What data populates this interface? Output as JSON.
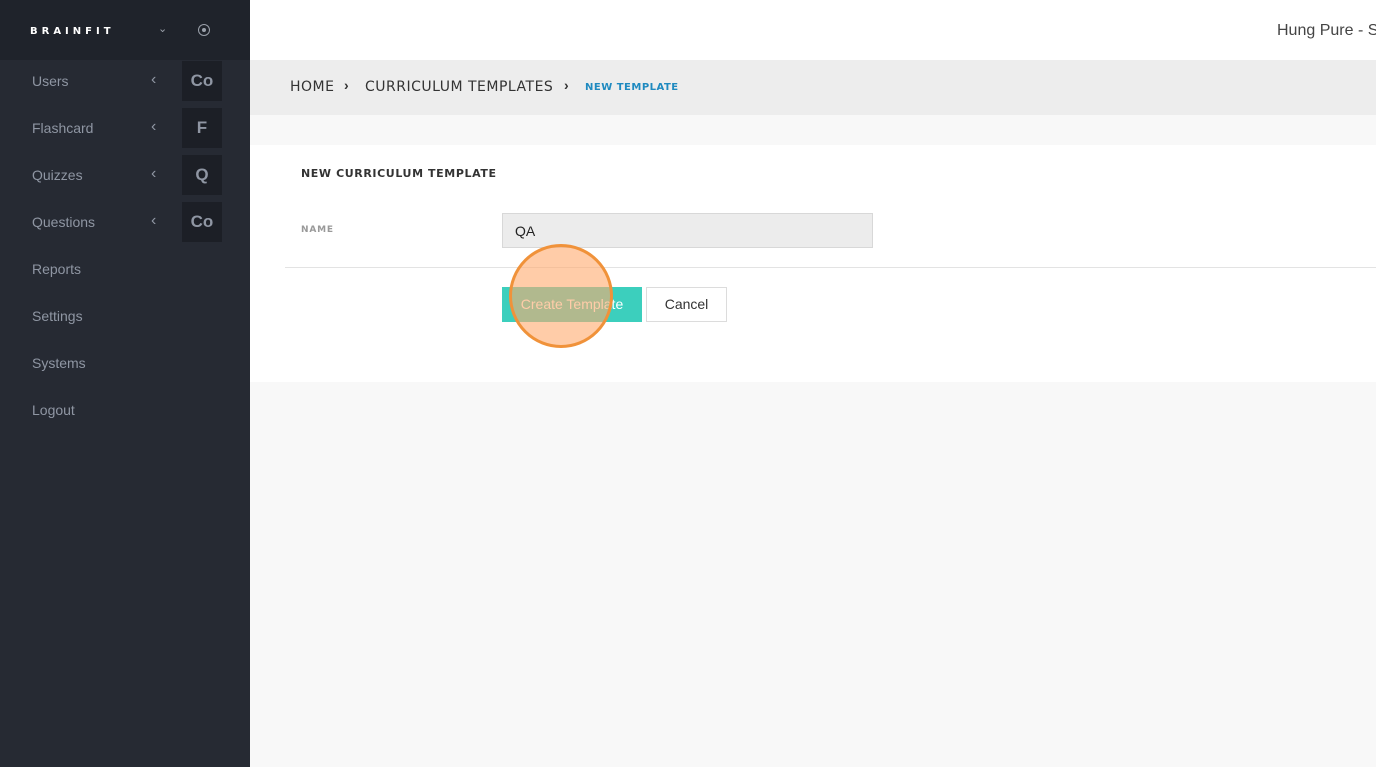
{
  "sidebar": {
    "brand": "BRAINFIT",
    "items": [
      {
        "label": "Users",
        "box": "Co"
      },
      {
        "label": "Flashcard",
        "box": "F"
      },
      {
        "label": "Quizzes",
        "box": "Q"
      },
      {
        "label": "Questions",
        "box": "Co"
      },
      {
        "label": "Reports"
      },
      {
        "label": "Settings"
      },
      {
        "label": "Systems"
      },
      {
        "label": "Logout"
      }
    ]
  },
  "topbar": {
    "user": "Hung Pure - S"
  },
  "breadcrumb": {
    "home": "HOME",
    "templates": "CURRICULUM TEMPLATES",
    "current": "NEW TEMPLATE"
  },
  "form": {
    "title": "NEW CURRICULUM TEMPLATE",
    "name_label": "NAME",
    "name_value": "QA",
    "create_label": "Create Template",
    "cancel_label": "Cancel"
  },
  "colors": {
    "sidebar": "#262a33",
    "accent": "#3ccfbd",
    "link": "#1f8ac0",
    "click_indicator": "#f0923a"
  }
}
